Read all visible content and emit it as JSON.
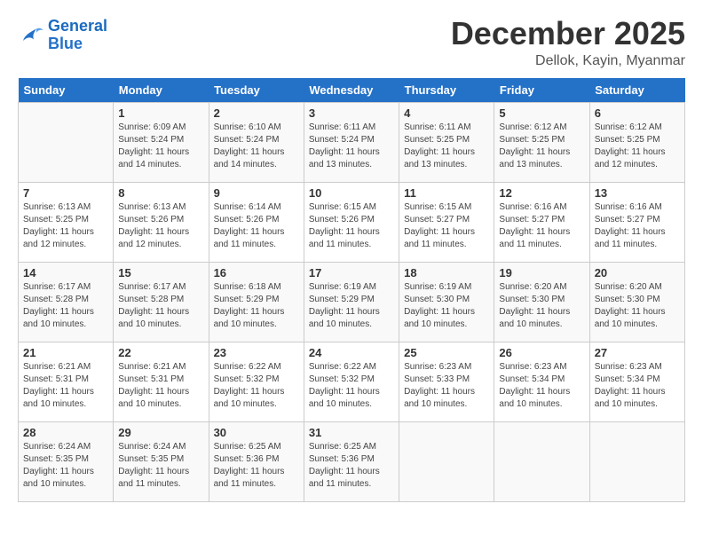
{
  "logo": {
    "line1": "General",
    "line2": "Blue"
  },
  "title": "December 2025",
  "location": "Dellok, Kayin, Myanmar",
  "days_of_week": [
    "Sunday",
    "Monday",
    "Tuesday",
    "Wednesday",
    "Thursday",
    "Friday",
    "Saturday"
  ],
  "weeks": [
    [
      {
        "day": "",
        "info": ""
      },
      {
        "day": "1",
        "info": "Sunrise: 6:09 AM\nSunset: 5:24 PM\nDaylight: 11 hours\nand 14 minutes."
      },
      {
        "day": "2",
        "info": "Sunrise: 6:10 AM\nSunset: 5:24 PM\nDaylight: 11 hours\nand 14 minutes."
      },
      {
        "day": "3",
        "info": "Sunrise: 6:11 AM\nSunset: 5:24 PM\nDaylight: 11 hours\nand 13 minutes."
      },
      {
        "day": "4",
        "info": "Sunrise: 6:11 AM\nSunset: 5:25 PM\nDaylight: 11 hours\nand 13 minutes."
      },
      {
        "day": "5",
        "info": "Sunrise: 6:12 AM\nSunset: 5:25 PM\nDaylight: 11 hours\nand 13 minutes."
      },
      {
        "day": "6",
        "info": "Sunrise: 6:12 AM\nSunset: 5:25 PM\nDaylight: 11 hours\nand 12 minutes."
      }
    ],
    [
      {
        "day": "7",
        "info": "Sunrise: 6:13 AM\nSunset: 5:25 PM\nDaylight: 11 hours\nand 12 minutes."
      },
      {
        "day": "8",
        "info": "Sunrise: 6:13 AM\nSunset: 5:26 PM\nDaylight: 11 hours\nand 12 minutes."
      },
      {
        "day": "9",
        "info": "Sunrise: 6:14 AM\nSunset: 5:26 PM\nDaylight: 11 hours\nand 11 minutes."
      },
      {
        "day": "10",
        "info": "Sunrise: 6:15 AM\nSunset: 5:26 PM\nDaylight: 11 hours\nand 11 minutes."
      },
      {
        "day": "11",
        "info": "Sunrise: 6:15 AM\nSunset: 5:27 PM\nDaylight: 11 hours\nand 11 minutes."
      },
      {
        "day": "12",
        "info": "Sunrise: 6:16 AM\nSunset: 5:27 PM\nDaylight: 11 hours\nand 11 minutes."
      },
      {
        "day": "13",
        "info": "Sunrise: 6:16 AM\nSunset: 5:27 PM\nDaylight: 11 hours\nand 11 minutes."
      }
    ],
    [
      {
        "day": "14",
        "info": "Sunrise: 6:17 AM\nSunset: 5:28 PM\nDaylight: 11 hours\nand 10 minutes."
      },
      {
        "day": "15",
        "info": "Sunrise: 6:17 AM\nSunset: 5:28 PM\nDaylight: 11 hours\nand 10 minutes."
      },
      {
        "day": "16",
        "info": "Sunrise: 6:18 AM\nSunset: 5:29 PM\nDaylight: 11 hours\nand 10 minutes."
      },
      {
        "day": "17",
        "info": "Sunrise: 6:19 AM\nSunset: 5:29 PM\nDaylight: 11 hours\nand 10 minutes."
      },
      {
        "day": "18",
        "info": "Sunrise: 6:19 AM\nSunset: 5:30 PM\nDaylight: 11 hours\nand 10 minutes."
      },
      {
        "day": "19",
        "info": "Sunrise: 6:20 AM\nSunset: 5:30 PM\nDaylight: 11 hours\nand 10 minutes."
      },
      {
        "day": "20",
        "info": "Sunrise: 6:20 AM\nSunset: 5:30 PM\nDaylight: 11 hours\nand 10 minutes."
      }
    ],
    [
      {
        "day": "21",
        "info": "Sunrise: 6:21 AM\nSunset: 5:31 PM\nDaylight: 11 hours\nand 10 minutes."
      },
      {
        "day": "22",
        "info": "Sunrise: 6:21 AM\nSunset: 5:31 PM\nDaylight: 11 hours\nand 10 minutes."
      },
      {
        "day": "23",
        "info": "Sunrise: 6:22 AM\nSunset: 5:32 PM\nDaylight: 11 hours\nand 10 minutes."
      },
      {
        "day": "24",
        "info": "Sunrise: 6:22 AM\nSunset: 5:32 PM\nDaylight: 11 hours\nand 10 minutes."
      },
      {
        "day": "25",
        "info": "Sunrise: 6:23 AM\nSunset: 5:33 PM\nDaylight: 11 hours\nand 10 minutes."
      },
      {
        "day": "26",
        "info": "Sunrise: 6:23 AM\nSunset: 5:34 PM\nDaylight: 11 hours\nand 10 minutes."
      },
      {
        "day": "27",
        "info": "Sunrise: 6:23 AM\nSunset: 5:34 PM\nDaylight: 11 hours\nand 10 minutes."
      }
    ],
    [
      {
        "day": "28",
        "info": "Sunrise: 6:24 AM\nSunset: 5:35 PM\nDaylight: 11 hours\nand 10 minutes."
      },
      {
        "day": "29",
        "info": "Sunrise: 6:24 AM\nSunset: 5:35 PM\nDaylight: 11 hours\nand 11 minutes."
      },
      {
        "day": "30",
        "info": "Sunrise: 6:25 AM\nSunset: 5:36 PM\nDaylight: 11 hours\nand 11 minutes."
      },
      {
        "day": "31",
        "info": "Sunrise: 6:25 AM\nSunset: 5:36 PM\nDaylight: 11 hours\nand 11 minutes."
      },
      {
        "day": "",
        "info": ""
      },
      {
        "day": "",
        "info": ""
      },
      {
        "day": "",
        "info": ""
      }
    ]
  ]
}
